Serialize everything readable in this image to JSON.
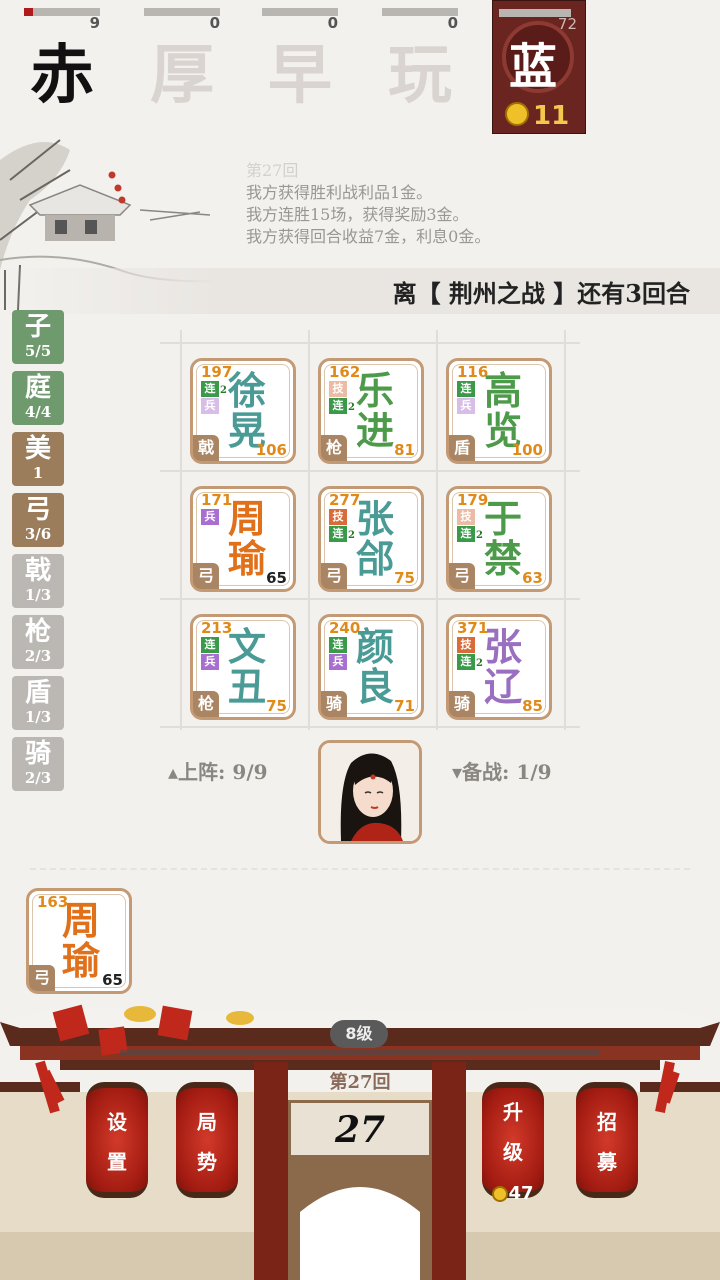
{
  "factions": [
    {
      "glyph": "赤",
      "count": "9",
      "active": true,
      "progress": 0.12
    },
    {
      "glyph": "厚",
      "count": "0",
      "active": false,
      "progress": 0
    },
    {
      "glyph": "早",
      "count": "0",
      "active": false,
      "progress": 0
    },
    {
      "glyph": "玩",
      "count": "0",
      "active": false,
      "progress": 0
    }
  ],
  "player": {
    "glyph": "蓝",
    "count": "72",
    "gold": "11"
  },
  "log": {
    "round_header": "第27回",
    "lines": [
      "我方获得胜利战利品1金。",
      "我方连胜15场，获得奖励3金。",
      "我方获得回合收益7金，利息0金。"
    ]
  },
  "banner": "离【 荆州之战 】还有3回合",
  "side_tabs": [
    {
      "label": "子",
      "count": "5/5",
      "style": "green"
    },
    {
      "label": "庭",
      "count": "4/4",
      "style": "green"
    },
    {
      "label": "美",
      "count": "1",
      "style": "brown"
    },
    {
      "label": "弓",
      "count": "3/6",
      "style": "brown"
    },
    {
      "label": "戟",
      "count": "1/3",
      "style": "grey"
    },
    {
      "label": "枪",
      "count": "2/3",
      "style": "grey"
    },
    {
      "label": "盾",
      "count": "1/3",
      "style": "grey"
    },
    {
      "label": "骑",
      "count": "2/3",
      "style": "grey"
    }
  ],
  "board": [
    {
      "name1": "徐",
      "name2": "晃",
      "hp": "197",
      "atk": "106",
      "type": "戟",
      "color": "teal",
      "tags": [
        {
          "t": "连",
          "k": "lian",
          "n": "2"
        },
        {
          "t": "兵",
          "k": "bing",
          "n": "",
          "faded": true
        }
      ]
    },
    {
      "name1": "乐",
      "name2": "进",
      "hp": "162",
      "atk": "81",
      "type": "枪",
      "color": "green",
      "tags": [
        {
          "t": "技",
          "k": "ji",
          "n": "",
          "faded": true
        },
        {
          "t": "连",
          "k": "lian",
          "n": "2"
        }
      ]
    },
    {
      "name1": "高",
      "name2": "览",
      "hp": "116",
      "atk": "100",
      "type": "盾",
      "color": "green",
      "tags": [
        {
          "t": "连",
          "k": "lian",
          "n": ""
        },
        {
          "t": "兵",
          "k": "bing",
          "n": "",
          "faded": true
        }
      ]
    },
    {
      "name1": "周",
      "name2": "瑜",
      "hp": "171",
      "atk": "65",
      "type": "弓",
      "color": "orange",
      "atk_black": true,
      "tags": [
        {
          "t": "兵",
          "k": "bing",
          "n": ""
        }
      ]
    },
    {
      "name1": "张",
      "name2": "郃",
      "hp": "277",
      "atk": "75",
      "type": "弓",
      "color": "teal",
      "tags": [
        {
          "t": "技",
          "k": "ji",
          "n": ""
        },
        {
          "t": "连",
          "k": "lian",
          "n": "2"
        }
      ]
    },
    {
      "name1": "于",
      "name2": "禁",
      "hp": "179",
      "atk": "63",
      "type": "弓",
      "color": "green",
      "tags": [
        {
          "t": "技",
          "k": "ji",
          "n": "",
          "faded": true
        },
        {
          "t": "连",
          "k": "lian",
          "n": "2"
        }
      ]
    },
    {
      "name1": "文",
      "name2": "丑",
      "hp": "213",
      "atk": "75",
      "type": "枪",
      "color": "teal",
      "tags": [
        {
          "t": "连",
          "k": "lian",
          "n": ""
        },
        {
          "t": "兵",
          "k": "bing",
          "n": ""
        }
      ]
    },
    {
      "name1": "颜",
      "name2": "良",
      "hp": "240",
      "atk": "71",
      "type": "骑",
      "color": "teal",
      "tags": [
        {
          "t": "连",
          "k": "lian",
          "n": ""
        },
        {
          "t": "兵",
          "k": "bing",
          "n": ""
        }
      ]
    },
    {
      "name1": "张",
      "name2": "辽",
      "hp": "371",
      "atk": "85",
      "type": "骑",
      "color": "purple",
      "tags": [
        {
          "t": "技",
          "k": "ji",
          "n": ""
        },
        {
          "t": "连",
          "k": "lian",
          "n": "2"
        }
      ]
    }
  ],
  "deploy": {
    "label": "上阵:",
    "value": "9/9"
  },
  "reserve": {
    "label": "备战:",
    "value": "1/9"
  },
  "bench": [
    {
      "name1": "周",
      "name2": "瑜",
      "hp": "163",
      "atk": "65",
      "type": "弓"
    }
  ],
  "level": "8级",
  "round_label": "第27回",
  "round_number": "27",
  "buttons": {
    "settings": [
      "设",
      "置"
    ],
    "situation": [
      "局",
      "势"
    ],
    "upgrade": [
      "升",
      "级"
    ],
    "upgrade_cost": "47",
    "recruit": [
      "招",
      "募"
    ]
  }
}
